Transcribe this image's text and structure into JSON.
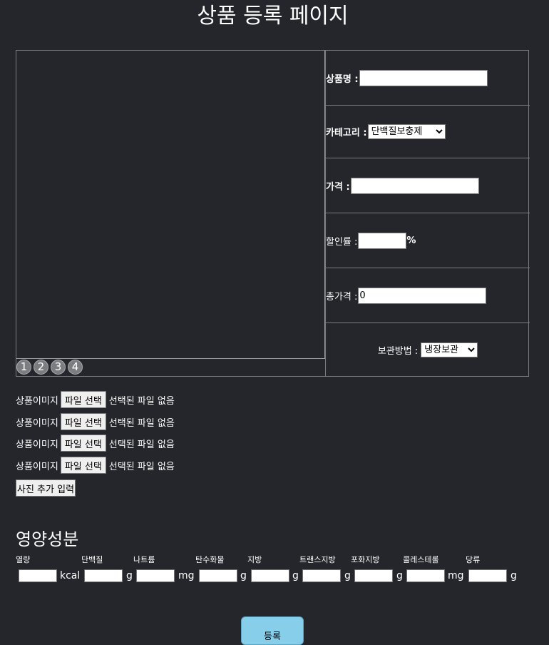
{
  "page": {
    "title": "상품 등록 페이지"
  },
  "gallery": {
    "dots": [
      "1",
      "2",
      "3",
      "4"
    ]
  },
  "form": {
    "name_label": "상품명 :",
    "name_value": "",
    "category_label": "카테고리 :",
    "category_selected": "단백질보충제",
    "price_label": "가격 :",
    "price_value": "",
    "discount_label": "할인률 :",
    "discount_value": "",
    "discount_unit": "%",
    "total_label": "총가격 :",
    "total_value": "0",
    "storage_label": "보관방법 :",
    "storage_selected": "냉장보관"
  },
  "images": {
    "rows": [
      {
        "label": "상품이미지",
        "button": "파일 선택",
        "status": "선택된 파일 없음"
      },
      {
        "label": "상품이미지",
        "button": "파일 선택",
        "status": "선택된 파일 없음"
      },
      {
        "label": "상품이미지",
        "button": "파일 선택",
        "status": "선택된 파일 없음"
      },
      {
        "label": "상품이미지",
        "button": "파일 선택",
        "status": "선택된 파일 없음"
      }
    ],
    "add_button": "사진 추가 입력"
  },
  "nutrition": {
    "title": "영양성분",
    "items": [
      {
        "label": "열량",
        "unit": "kcal"
      },
      {
        "label": "단백질",
        "unit": "g"
      },
      {
        "label": "나트륨",
        "unit": "mg"
      },
      {
        "label": "탄수화물",
        "unit": "g"
      },
      {
        "label": "지방",
        "unit": "g"
      },
      {
        "label": "트랜스지방",
        "unit": "g"
      },
      {
        "label": "포화지방",
        "unit": "g"
      },
      {
        "label": "콜레스테롤",
        "unit": "mg"
      },
      {
        "label": "당류",
        "unit": "g"
      }
    ]
  },
  "submit": {
    "label": "등록"
  }
}
